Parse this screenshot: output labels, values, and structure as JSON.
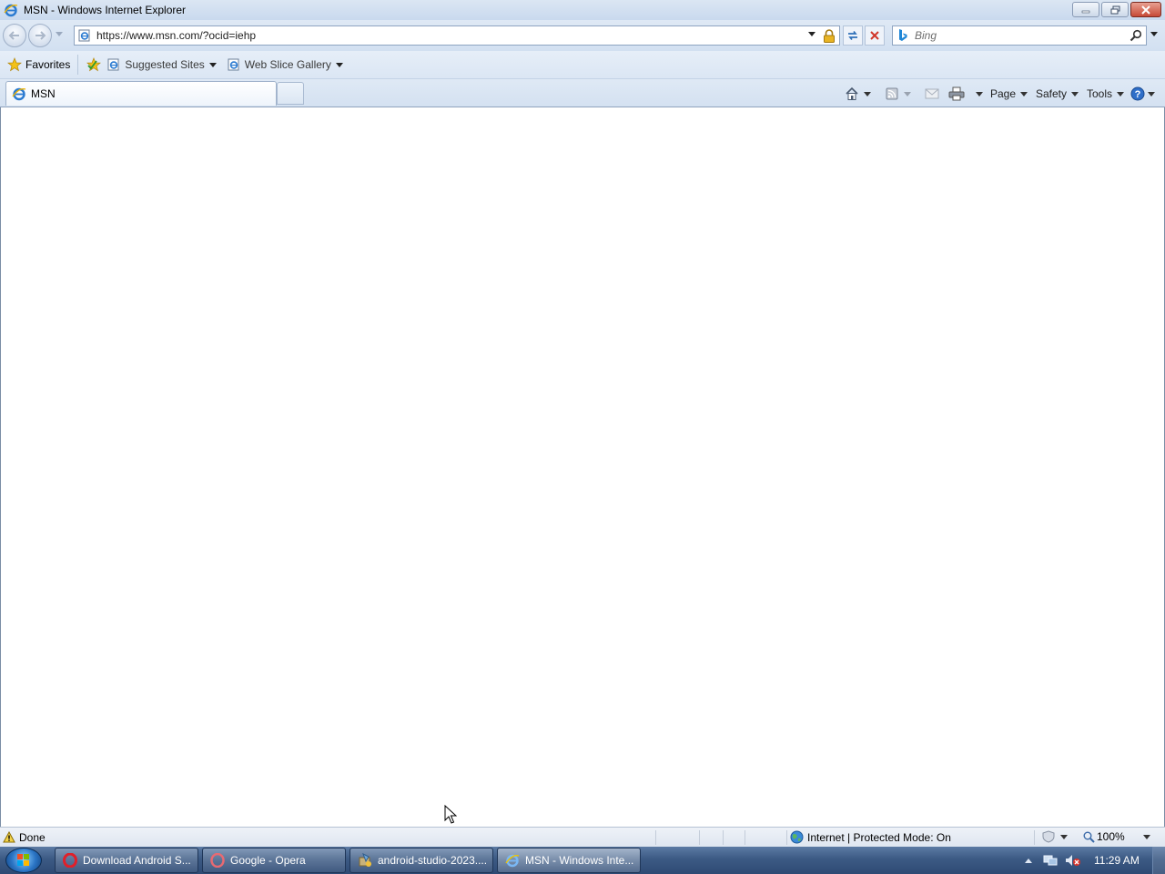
{
  "window": {
    "title": "MSN - Windows Internet Explorer"
  },
  "address": {
    "url": "https://www.msn.com/?ocid=iehp"
  },
  "search": {
    "placeholder": "Bing"
  },
  "favorites_bar": {
    "favorites_label": "Favorites",
    "suggested_sites_label": "Suggested Sites",
    "web_slice_label": "Web Slice Gallery"
  },
  "tabs": [
    {
      "label": "MSN"
    }
  ],
  "command_bar": {
    "page_label": "Page",
    "safety_label": "Safety",
    "tools_label": "Tools"
  },
  "status": {
    "text": "Done",
    "zone": "Internet | Protected Mode: On",
    "zoom": "100%"
  },
  "taskbar": {
    "items": [
      {
        "label": "Download Android S...",
        "icon": "opera-icon"
      },
      {
        "label": "Google - Opera",
        "icon": "opera-icon"
      },
      {
        "label": "android-studio-2023....",
        "icon": "installer-icon"
      },
      {
        "label": "MSN - Windows Inte...",
        "icon": "ie-icon"
      }
    ],
    "clock": "11:29 AM"
  },
  "colors": {
    "chrome_blue": "#d2e0f1",
    "taskbar": "#3c5a84",
    "close_red": "#c74a37"
  }
}
